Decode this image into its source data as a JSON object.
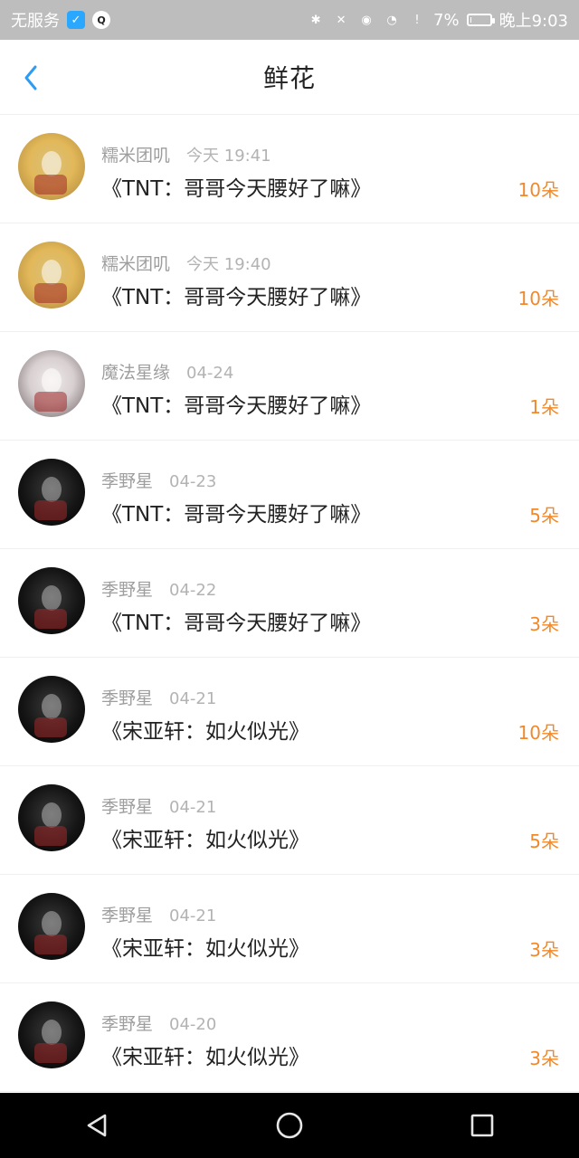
{
  "status_bar": {
    "carrier": "无服务",
    "battery_percent": "7%",
    "battery_level": 0.07,
    "time": "晚上9:03",
    "icons": [
      "shield-icon",
      "qq-icon",
      "bluetooth-icon",
      "mute-icon",
      "eye-icon",
      "wifi-icon",
      "alert-icon",
      "battery-icon"
    ]
  },
  "header": {
    "title": "鲜花"
  },
  "items": [
    {
      "name": "糯米团叽",
      "time": "今天 19:41",
      "title": "《TNT：哥哥今天腰好了嘛》",
      "count": "10朵",
      "avatar": "yellow"
    },
    {
      "name": "糯米团叽",
      "time": "今天 19:40",
      "title": "《TNT：哥哥今天腰好了嘛》",
      "count": "10朵",
      "avatar": "yellow"
    },
    {
      "name": "魔法星缘",
      "time": "04-24",
      "title": "《TNT：哥哥今天腰好了嘛》",
      "count": "1朵",
      "avatar": "girl"
    },
    {
      "name": "季野星",
      "time": "04-23",
      "title": "《TNT：哥哥今天腰好了嘛》",
      "count": "5朵",
      "avatar": "dark"
    },
    {
      "name": "季野星",
      "time": "04-22",
      "title": "《TNT：哥哥今天腰好了嘛》",
      "count": "3朵",
      "avatar": "dark"
    },
    {
      "name": "季野星",
      "time": "04-21",
      "title": "《宋亚轩：如火似光》",
      "count": "10朵",
      "avatar": "dark"
    },
    {
      "name": "季野星",
      "time": "04-21",
      "title": "《宋亚轩：如火似光》",
      "count": "5朵",
      "avatar": "dark"
    },
    {
      "name": "季野星",
      "time": "04-21",
      "title": "《宋亚轩：如火似光》",
      "count": "3朵",
      "avatar": "dark"
    },
    {
      "name": "季野星",
      "time": "04-20",
      "title": "《宋亚轩：如火似光》",
      "count": "3朵",
      "avatar": "dark"
    }
  ],
  "colors": {
    "accent": "#2e9cf3",
    "count": "#f1892b",
    "status_bar": "#bdbdbd"
  }
}
